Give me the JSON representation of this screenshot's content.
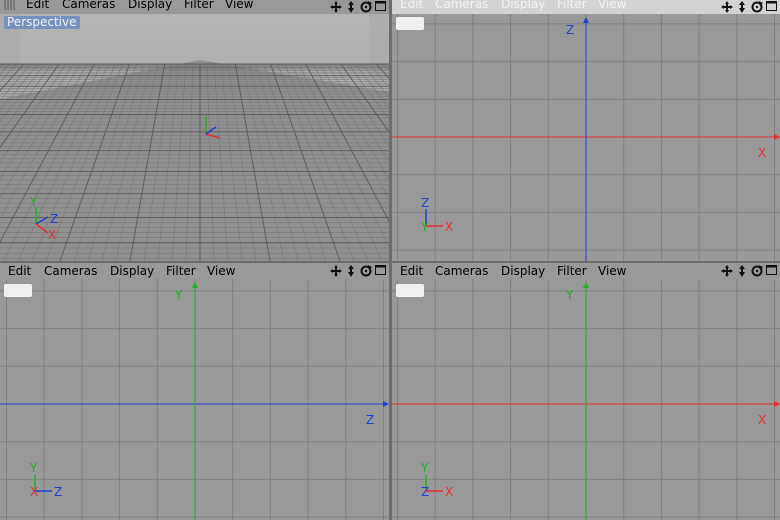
{
  "menu": {
    "edit": "Edit",
    "cameras": "Cameras",
    "display": "Display",
    "filter": "Filter",
    "view": "View"
  },
  "viewports": {
    "perspective": {
      "label": "Perspective"
    },
    "top": {
      "axis_h": "X",
      "axis_v": "Z"
    },
    "front": {
      "axis_h": "Z",
      "axis_v": "Y"
    },
    "right": {
      "axis_h": "X",
      "axis_v": "Y"
    }
  },
  "gizmo": {
    "x": "X",
    "y": "Y",
    "z": "Z"
  },
  "icons": [
    "move-icon",
    "zoom-icon",
    "rotate-icon",
    "maximize-icon"
  ],
  "colors": {
    "viewport_bg": "#999999",
    "grid": "#808080",
    "x_axis": "#e03030",
    "y_axis": "#20b020",
    "z_axis": "#2040d0",
    "label_bg": "#7791c0"
  }
}
